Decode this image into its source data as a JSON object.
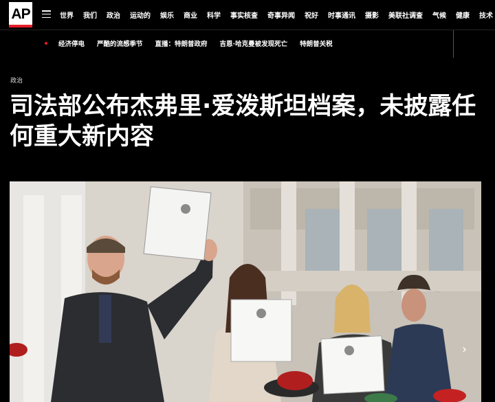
{
  "logo": {
    "text": "AP"
  },
  "nav": {
    "items": [
      "世界",
      "我们",
      "政治",
      "运动的",
      "娱乐",
      "商业",
      "科学",
      "事实核查",
      "奇事异闻",
      "祝好",
      "时事通讯",
      "摄影",
      "美联社调查",
      "气候",
      "健康",
      "技术"
    ]
  },
  "subnav": {
    "items": [
      "经济停电",
      "严酷的流感季节",
      "直播：特朗普政府",
      "吉恩·哈克曼被发现死亡",
      "特朗普关税"
    ]
  },
  "article": {
    "section": "政治",
    "headline": "司法部公布杰弗里·爱泼斯坦档案，未披露任何重大新内容"
  },
  "colors": {
    "accent": "#e51d2a",
    "background": "#000000"
  }
}
